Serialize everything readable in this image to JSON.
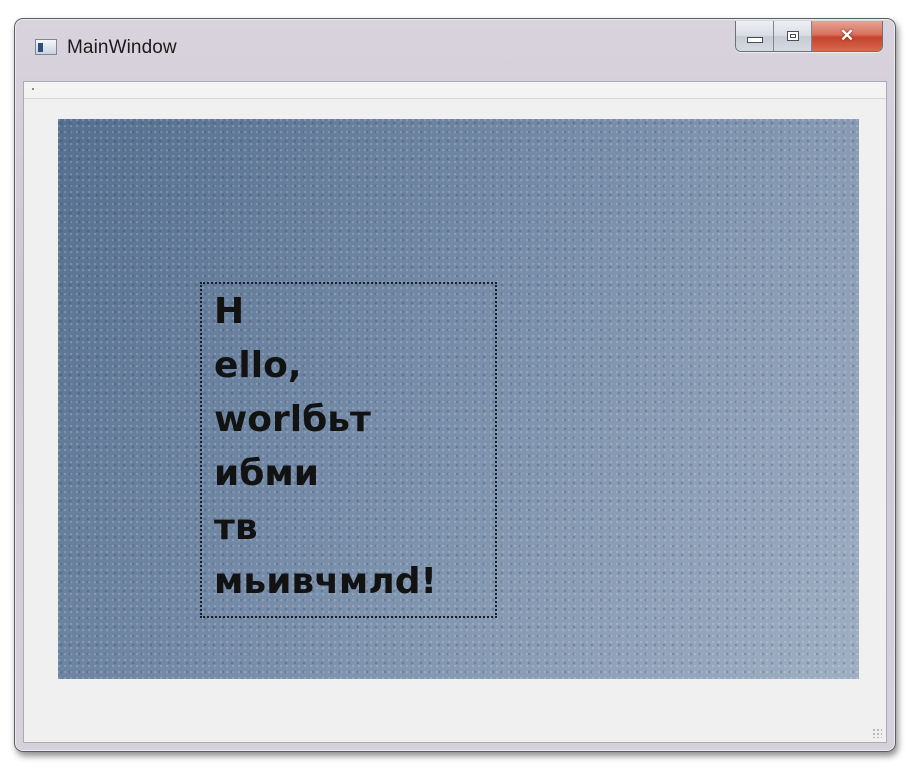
{
  "window": {
    "title": "MainWindow",
    "close_glyph": "✕"
  },
  "icons": {
    "app": "application-window-icon",
    "minimize": "minimize-icon",
    "maximize": "maximize-icon",
    "close": "close-icon"
  },
  "colors": {
    "close_button": "#c4432b",
    "canvas_background": "#6f85a0",
    "text": "#121212"
  },
  "text_block": {
    "lines": [
      "H",
      "ello,",
      "worlбьт",
      "ибми",
      "тв",
      "мьивчмлd!"
    ]
  }
}
